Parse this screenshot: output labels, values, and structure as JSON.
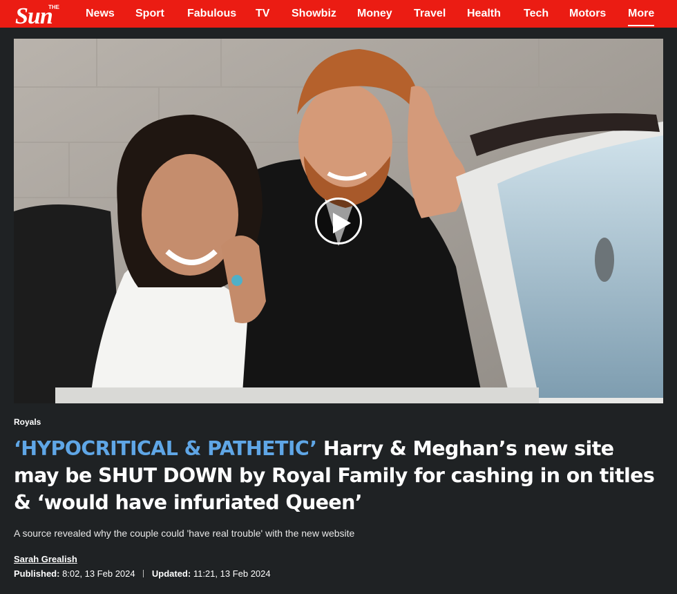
{
  "brand": {
    "name": "The Sun",
    "logo_small": "THE",
    "logo_big": "Sun",
    "color": "#eb1c13"
  },
  "nav": {
    "items": [
      {
        "label": "News"
      },
      {
        "label": "Sport"
      },
      {
        "label": "Fabulous"
      },
      {
        "label": "TV"
      },
      {
        "label": "Showbiz"
      },
      {
        "label": "Money"
      },
      {
        "label": "Travel"
      },
      {
        "label": "Health"
      },
      {
        "label": "Tech"
      },
      {
        "label": "Motors"
      },
      {
        "label": "More",
        "active": true
      }
    ]
  },
  "hero": {
    "media": "video",
    "play_icon": "play-icon"
  },
  "article": {
    "section": "Royals",
    "kicker": "‘HYPOCRITICAL & PATHETIC’",
    "title": "Harry & Meghan’s new site may be SHUT DOWN by Royal Family for cashing in on titles & ‘would have infuriated Queen’",
    "standfirst": "A source revealed why the couple could 'have real trouble' with the new website",
    "author": "Sarah Grealish",
    "published_label": "Published:",
    "published": "8:02, 13 Feb 2024",
    "updated_label": "Updated:",
    "updated": "11:21, 13 Feb 2024",
    "kicker_color": "#5fa6e6"
  }
}
